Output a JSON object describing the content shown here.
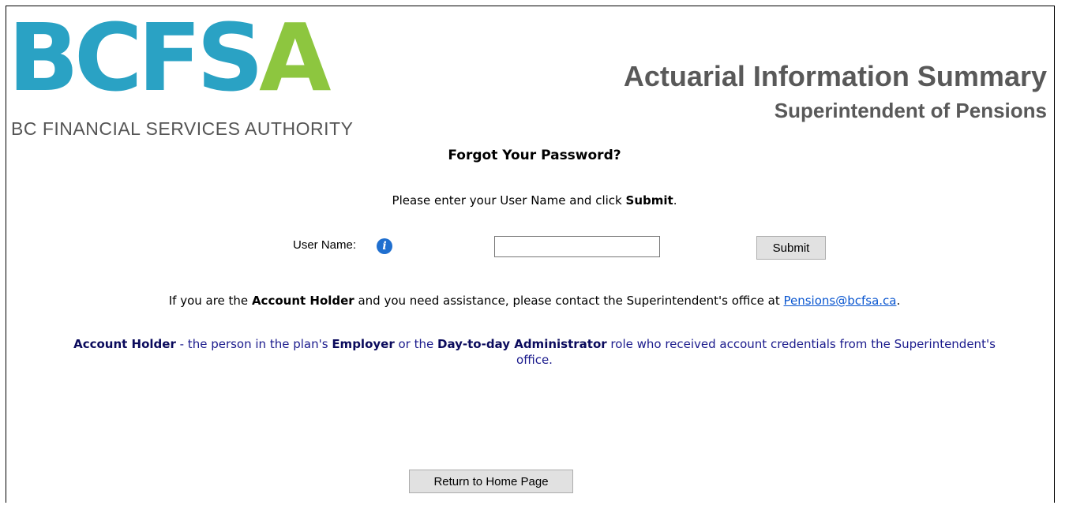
{
  "logo": {
    "main_text": "BCFS",
    "accent_letter": "A",
    "subtitle": "BC FINANCIAL SERVICES AUTHORITY",
    "colors": {
      "blue": "#2aa2c4",
      "green": "#8dc63f"
    }
  },
  "header": {
    "title": "Actuarial Information Summary",
    "subtitle": "Superintendent of Pensions"
  },
  "page": {
    "title": "Forgot Your Password?",
    "instruction_prefix": "Please enter your User Name and click ",
    "instruction_bold": "Submit",
    "instruction_suffix": "."
  },
  "form": {
    "user_name_label": "User Name:",
    "info_icon": "info-icon",
    "user_name_value": "",
    "submit_label": "Submit"
  },
  "assistance": {
    "prefix": "If you are the ",
    "bold": "Account Holder",
    "middle": " and you need assistance, please contact the Superintendent's office at ",
    "email": "Pensions@bcfsa.ca",
    "suffix": "."
  },
  "definition": {
    "term": "Account Holder",
    "part1": " - the person in the plan's ",
    "employer": "Employer",
    "part2": " or the ",
    "administrator": "Day-to-day Administrator",
    "part3": " role who received account credentials from the Superintendent's office."
  },
  "footer": {
    "home_button_label": "Return to Home Page"
  }
}
